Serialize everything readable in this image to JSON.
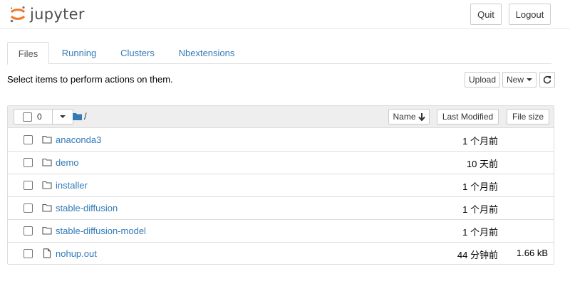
{
  "header": {
    "logo_text": "jupyter",
    "quit_label": "Quit",
    "logout_label": "Logout"
  },
  "tabs": [
    {
      "label": "Files",
      "active": true
    },
    {
      "label": "Running",
      "active": false
    },
    {
      "label": "Clusters",
      "active": false
    },
    {
      "label": "Nbextensions",
      "active": false
    }
  ],
  "toolbar": {
    "hint": "Select items to perform actions on them.",
    "upload_label": "Upload",
    "new_label": "New",
    "refresh_icon": "refresh-icon"
  },
  "list_header": {
    "selected_count": "0",
    "path": "/",
    "name_label": "Name",
    "last_modified_label": "Last Modified",
    "file_size_label": "File size"
  },
  "files": [
    {
      "name": "anaconda3",
      "type": "folder",
      "modified": "1 个月前",
      "size": ""
    },
    {
      "name": "demo",
      "type": "folder",
      "modified": "10 天前",
      "size": ""
    },
    {
      "name": "installer",
      "type": "folder",
      "modified": "1 个月前",
      "size": ""
    },
    {
      "name": "stable-diffusion",
      "type": "folder",
      "modified": "1 个月前",
      "size": ""
    },
    {
      "name": "stable-diffusion-model",
      "type": "folder",
      "modified": "1 个月前",
      "size": ""
    },
    {
      "name": "nohup.out",
      "type": "file",
      "modified": "44 分钟前",
      "size": "1.66 kB"
    }
  ],
  "colors": {
    "link": "#337ab7",
    "logo_orange": "#f37726",
    "header_bg": "#eeeeee"
  }
}
